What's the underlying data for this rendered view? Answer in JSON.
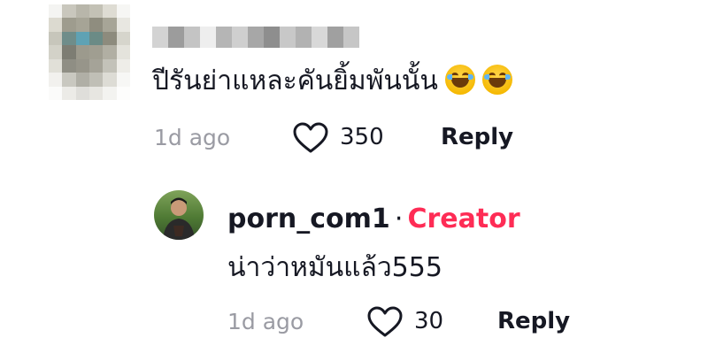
{
  "comment": {
    "text": "ปีรันย่าแหละคันยิ้มพันนั้น",
    "emojis": [
      "face-with-tears-of-joy",
      "face-with-tears-of-joy"
    ],
    "time": "1d ago",
    "likes": "350",
    "reply_label": "Reply"
  },
  "reply": {
    "username": "porn_com1",
    "separator": "·",
    "badge": "Creator",
    "text": "น่าว่าหมันแล้ว555",
    "time": "1d ago",
    "likes": "30",
    "reply_label": "Reply"
  },
  "colors": {
    "creator_badge": "#fe2c55",
    "meta_text": "#9a9ba3",
    "primary_text": "#161823"
  }
}
